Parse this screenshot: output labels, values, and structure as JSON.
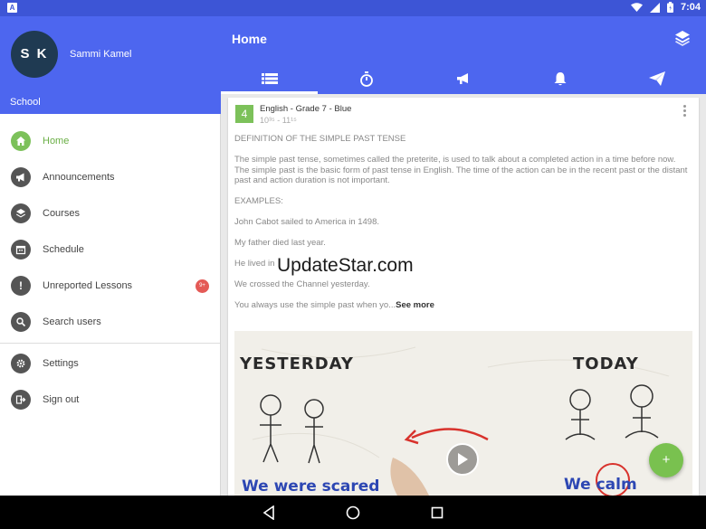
{
  "status_bar": {
    "notification_letter": "A",
    "time": "7:04"
  },
  "drawer": {
    "avatar_initials": "S K",
    "user_name": "Sammi Kamel",
    "school": "School",
    "items": [
      {
        "label": "Home",
        "icon": "home-icon",
        "active": true
      },
      {
        "label": "Announcements",
        "icon": "megaphone-icon"
      },
      {
        "label": "Courses",
        "icon": "layers-icon"
      },
      {
        "label": "Schedule",
        "icon": "calendar-icon"
      },
      {
        "label": "Unreported Lessons",
        "icon": "exclamation-icon",
        "badge": "9+"
      },
      {
        "label": "Search users",
        "icon": "search-icon"
      }
    ],
    "footer_items": [
      {
        "label": "Settings",
        "icon": "gear-icon"
      },
      {
        "label": "Sign out",
        "icon": "sign-out-icon"
      }
    ]
  },
  "appbar": {
    "title": "Home",
    "tabs": [
      {
        "icon": "list-icon",
        "active": true
      },
      {
        "icon": "timer-icon"
      },
      {
        "icon": "megaphone-icon"
      },
      {
        "icon": "bell-icon"
      },
      {
        "icon": "send-icon"
      }
    ]
  },
  "post": {
    "grade": "4",
    "course": "English - Grade 7 - Blue",
    "time": "10³⁵ - 11¹⁵",
    "paragraphs": [
      "DEFINITION OF THE SIMPLE PAST TENSE",
      "The simple past tense, sometimes called the preterite, is used to talk about a completed action in a time before now. The simple past is the basic form of past tense in English. The time of the action can be in the recent past or the distant past and action duration is not important.",
      "EXAMPLES:",
      "John Cabot sailed to America in 1498.",
      "My father died last year.",
      "He lived in",
      "We crossed the Channel yesterday."
    ],
    "last_line": "You always use the simple past when yo...",
    "see_more": "See more",
    "media": {
      "word_left": "YESTERDAY",
      "word_right": "TODAY",
      "caption_left": "We were scared",
      "caption_right": "We calm"
    }
  },
  "watermark": "UpdateStar.com",
  "fab_label": "+",
  "colors": {
    "primary": "#4d66ef",
    "statusbar": "#3d55d6",
    "accent": "#7cc15a",
    "badge": "#e45a56"
  }
}
